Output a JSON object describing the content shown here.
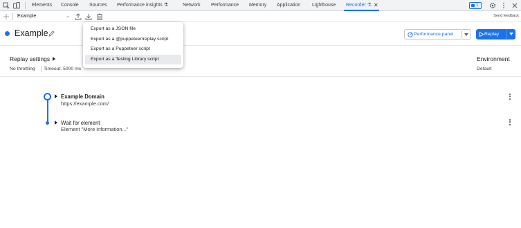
{
  "devtools": {
    "tabs": [
      {
        "label": "Elements"
      },
      {
        "label": "Console"
      },
      {
        "label": "Sources"
      },
      {
        "label": "Performance insights ⚗"
      },
      {
        "label": "Network"
      },
      {
        "label": "Performance"
      },
      {
        "label": "Memory"
      },
      {
        "label": "Application"
      },
      {
        "label": "Lighthouse"
      },
      {
        "label": "Recorder ⚗"
      }
    ],
    "active_tab": "Recorder",
    "issues_count": "1"
  },
  "toolbar": {
    "add_icon": "plus-icon",
    "recording_name": "Example",
    "send_feedback": "Send feedback"
  },
  "recording": {
    "title": "Example",
    "performance_panel_label": "Performance panel",
    "replay_label": "Replay"
  },
  "settings": {
    "replay_settings_label": "Replay settings",
    "throttling": "No throttling",
    "timeout": "Timeout: 5000 ms",
    "environment_label": "Environment",
    "environment_value": "Default"
  },
  "steps": [
    {
      "title": "Example Domain",
      "subtitle": "https://example.com/"
    },
    {
      "title": "Wait for element",
      "subtitle": "Element \"More information...\""
    }
  ],
  "export_menu": {
    "items": [
      {
        "label": "Export as a JSON file"
      },
      {
        "label": "Export as a @puppeteer/replay script"
      },
      {
        "label": "Export as a Puppeteer script"
      },
      {
        "label": "Export as a Testing Library script"
      }
    ],
    "highlighted_index": 3
  },
  "colors": {
    "accent": "#1a73e8",
    "menu_hover": "#e8eaed"
  }
}
